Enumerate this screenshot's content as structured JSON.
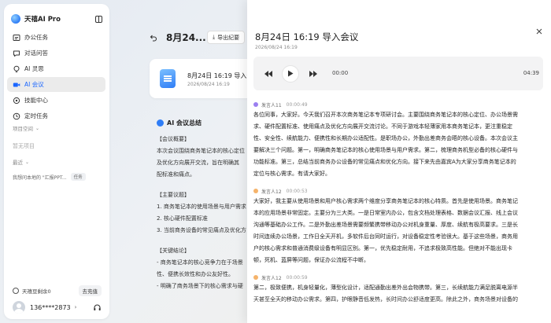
{
  "app": {
    "title": "天禧AI Pro"
  },
  "sidebar": {
    "items": [
      {
        "label": "办公任务",
        "icon": "office-task-icon"
      },
      {
        "label": "对话问答",
        "icon": "chat-icon"
      },
      {
        "label": "AI 灵思",
        "icon": "idea-icon"
      },
      {
        "label": "AI 会议",
        "icon": "meeting-icon",
        "active": true
      },
      {
        "label": "技能中心",
        "icon": "skills-icon"
      },
      {
        "label": "定时任务",
        "icon": "clock-icon"
      }
    ],
    "project_space_label": "项目空间",
    "no_project_text": "暂无项目",
    "recent_label": "最近",
    "recent_item_text": "我想问本地的 \"汇报PPT...",
    "recent_item_badge": "任务",
    "balance_text": "天禧豆剩余0",
    "recharge_label": "去充值",
    "user_phone": "136****2873"
  },
  "document": {
    "title_short": "8月24...",
    "export_label": "导出纪要",
    "card_title": "8月24日 16:19 导入会议",
    "card_date": "2026/08/24 16:19",
    "summary_title": "AI 会议总结",
    "summary_lines": [
      "【会议概要】",
      "本次会议围绕商务笔记本的核心定位",
      "及优化方向展开交流，旨在明确其",
      "配标准和痛点。",
      "",
      "【主要议题】",
      "1. 商务笔记本的使用场景与用户需求",
      "2. 核心硬件配置标准",
      "3. 当前商务设备的常见痛点及优化方",
      "",
      "【关键结论】",
      "- 商务笔记本的核心竞争力在于场景",
      "性、便携长效性和办公友好性。",
      "- 明确了商务场景下的核心需求与硬"
    ]
  },
  "panel": {
    "title": "8月24日 16:19 导入会议",
    "date": "2026/08/24 16:19",
    "time_start": "00:00",
    "time_end": "04:39",
    "segments": [
      {
        "speaker": "发言人11",
        "time": "00:00:49",
        "color": "#9b7ff0",
        "lines": [
          "各位同事，大家好。今天我们召开本次商务笔记本专项研讨会。主要围绕商务笔记本的核心定位、办公场景需",
          "求、硬件配置标准、使用痛点及优化方向展开交流讨论。不同于游戏本轻薄家用本商务笔记本，更注重稳定",
          "性、安全性、续航能力、便携性和长期办公适配性。是职场办公，外勤出差商务会晤的核心设备。本次会议主",
          "要解决三个问题。第一，明确商务笔记本的核心使用场景与用户需求。第二，梳理商务机型必备的核心硬件与",
          "功能标准。第三，总结当前商务办公设备的常见痛点和优化方向。接下来先由嘉宾A为大家分享商务笔记本的",
          "定位与核心需求。有请大家好。"
        ]
      },
      {
        "speaker": "发言人12",
        "time": "00:00:53",
        "color": "#f5b36b",
        "lines": [
          "大家好，我主要从使用场景和用户核心需求两个维度分享商务笔记本的核心特质。首先是使用场景。商务笔记",
          "本的应用场景非常固定。主要分为三大类。一是日常室内办公，包含文档处理表格、数据会议汇报、线上会议",
          "沟通等基础办公工作。二是外勤出差场景需要频繁携带移动办公对机身重量、厚度、续航有极高要求。三是长",
          "时间连续办公场景，工作日全天开机，多软件后台同时运行，对设备稳定性考验很大。基于这些场景，商务用",
          "户的核心需求和普通消费级设备有明显区别。第一，优先稳定耐用，不追求极致高性能。但绝对不能出现卡",
          "顿，死机、蓝屏等问题，保证办公流程不中断。"
        ]
      },
      {
        "speaker": "发言人12",
        "time": "00:00:59",
        "color": "#f5b36b",
        "lines": [
          "第二，极致便携，机身轻量化，薄型化设计，适配通勤出差外出会物携带。第三，长续航能力满足脱离电源半",
          "天甚至全天的移动办公需求。第四，护眼静音低发热，长时间办公舒适度更高。除此之外，商务场景对设备的"
        ]
      }
    ]
  }
}
